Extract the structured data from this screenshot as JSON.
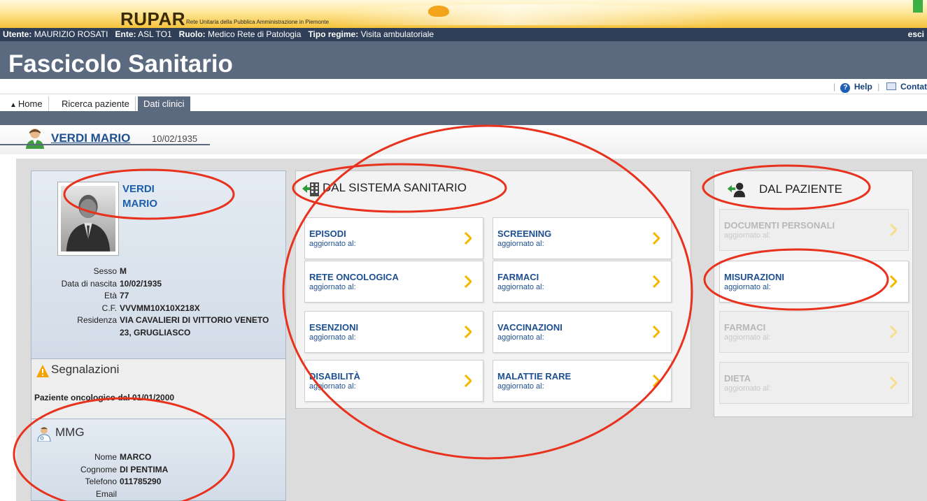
{
  "banner": {
    "logo": "RUPAR",
    "subtitle": "Rete Unitaria della Pubblica Amministrazione in Piemonte"
  },
  "userbar": {
    "utente_label": "Utente:",
    "utente_value": "MAURIZIO ROSATI",
    "ente_label": "Ente:",
    "ente_value": "ASL TO1",
    "ruolo_label": "Ruolo:",
    "ruolo_value": "Medico Rete di Patologia",
    "regime_label": "Tipo regime:",
    "regime_value": "Visita ambulatoriale",
    "logout": "esci"
  },
  "app_title": "Fascicolo Sanitario",
  "toplinks": {
    "help": "Help",
    "contacts": "Contat"
  },
  "nav": {
    "tabs": [
      {
        "label": "Home",
        "icon": "home-icon"
      },
      {
        "label": "Ricerca paziente"
      },
      {
        "label": "Dati clinici",
        "active": true
      }
    ]
  },
  "patient": {
    "full_name": "VERDI MARIO",
    "dob": "10/02/1935",
    "surname": "VERDI",
    "first_name": "MARIO",
    "details": [
      {
        "label": "Sesso",
        "value": "M"
      },
      {
        "label": "Data di nascita",
        "value": "10/02/1935"
      },
      {
        "label": "Età",
        "value": "77"
      },
      {
        "label": "C.F.",
        "value": "VVVMM10X10X218X"
      },
      {
        "label": "Residenza",
        "value": "VIA CAVALIERI DI VITTORIO VENETO",
        "value2": "23, GRUGLIASCO"
      }
    ]
  },
  "segnalazioni": {
    "title": "Segnalazioni",
    "text": "Paziente oncologico dal 01/01/2000"
  },
  "mmg": {
    "title": "MMG",
    "details": [
      {
        "label": "Nome",
        "value": "MARCO"
      },
      {
        "label": "Cognome",
        "value": "DI PENTIMA"
      },
      {
        "label": "Telefono",
        "value": "011785290"
      },
      {
        "label": "Email",
        "value": ""
      }
    ]
  },
  "sistema": {
    "title": "DAL SISTEMA SANITARIO",
    "tiles": [
      {
        "title": "EPISODI",
        "sub": "aggiornato al:"
      },
      {
        "title": "SCREENING",
        "sub": "aggiornato al:"
      },
      {
        "title": "RETE ONCOLOGICA",
        "sub": "aggiornato al:"
      },
      {
        "title": "FARMACI",
        "sub": "aggiornato al:"
      },
      {
        "title": "ESENZIONI",
        "sub": "aggiornato al:"
      },
      {
        "title": "VACCINAZIONI",
        "sub": "aggiornato al:"
      },
      {
        "title": "DISABILITÀ",
        "sub": "aggiornato al:"
      },
      {
        "title": "MALATTIE RARE",
        "sub": "aggiornato al:"
      }
    ]
  },
  "paziente": {
    "title": "DAL PAZIENTE",
    "tiles": [
      {
        "title": "DOCUMENTI PERSONALI",
        "sub": "aggiornato al:",
        "enabled": false
      },
      {
        "title": "MISURAZIONI",
        "sub": "aggiornato al:",
        "enabled": true
      },
      {
        "title": "FARMACI",
        "sub": "aggiornato al:",
        "enabled": false
      },
      {
        "title": "DIETA",
        "sub": "aggiornato al:",
        "enabled": false
      }
    ]
  },
  "colors": {
    "header_gray": "#5c6a80",
    "user_bar": "#2f3f57",
    "link_blue": "#1d4f91",
    "arrow_gold": "#f5b800",
    "annotation_red": "#e8321e"
  }
}
